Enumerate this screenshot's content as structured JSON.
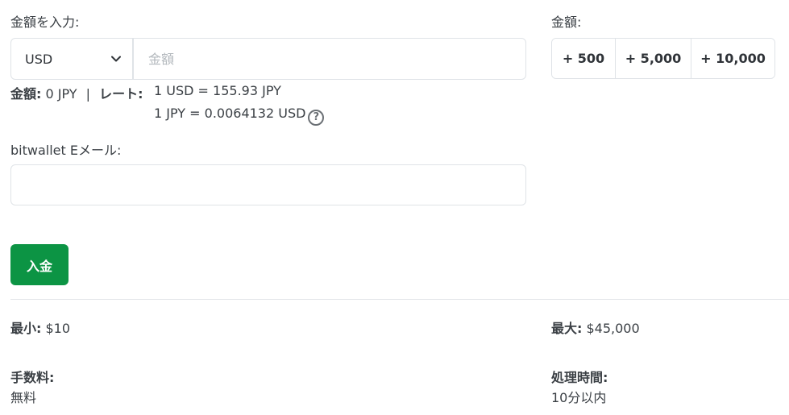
{
  "form": {
    "amount_label": "金額を入力:",
    "currency_selected": "USD",
    "amount_placeholder": "金額",
    "quick_label": "金額:",
    "quick_amounts": [
      "+ 500",
      "+ 5,000",
      "+ 10,000"
    ],
    "summary": {
      "amount_key": "金額:",
      "amount_value": " 0 JPY",
      "separator": "|",
      "rate_key": "レート:",
      "rate_line1": "1 USD = 155.93 JPY",
      "rate_line2": "1 JPY = 0.0064132 USD",
      "help_icon": "?"
    },
    "email_label": "bitwallet Eメール:",
    "email_value": "",
    "deposit_button": "入金"
  },
  "details": {
    "min_key": "最小:",
    "min_value": " $10",
    "max_key": "最大:",
    "max_value": " $45,000",
    "fee_key": "手数料:",
    "fee_value": "無料",
    "time_key": "処理時間:",
    "time_value": "10分以内"
  },
  "colors": {
    "primary_button": "#0c9444",
    "border": "#dfe3e7",
    "text": "#3a3f44"
  }
}
